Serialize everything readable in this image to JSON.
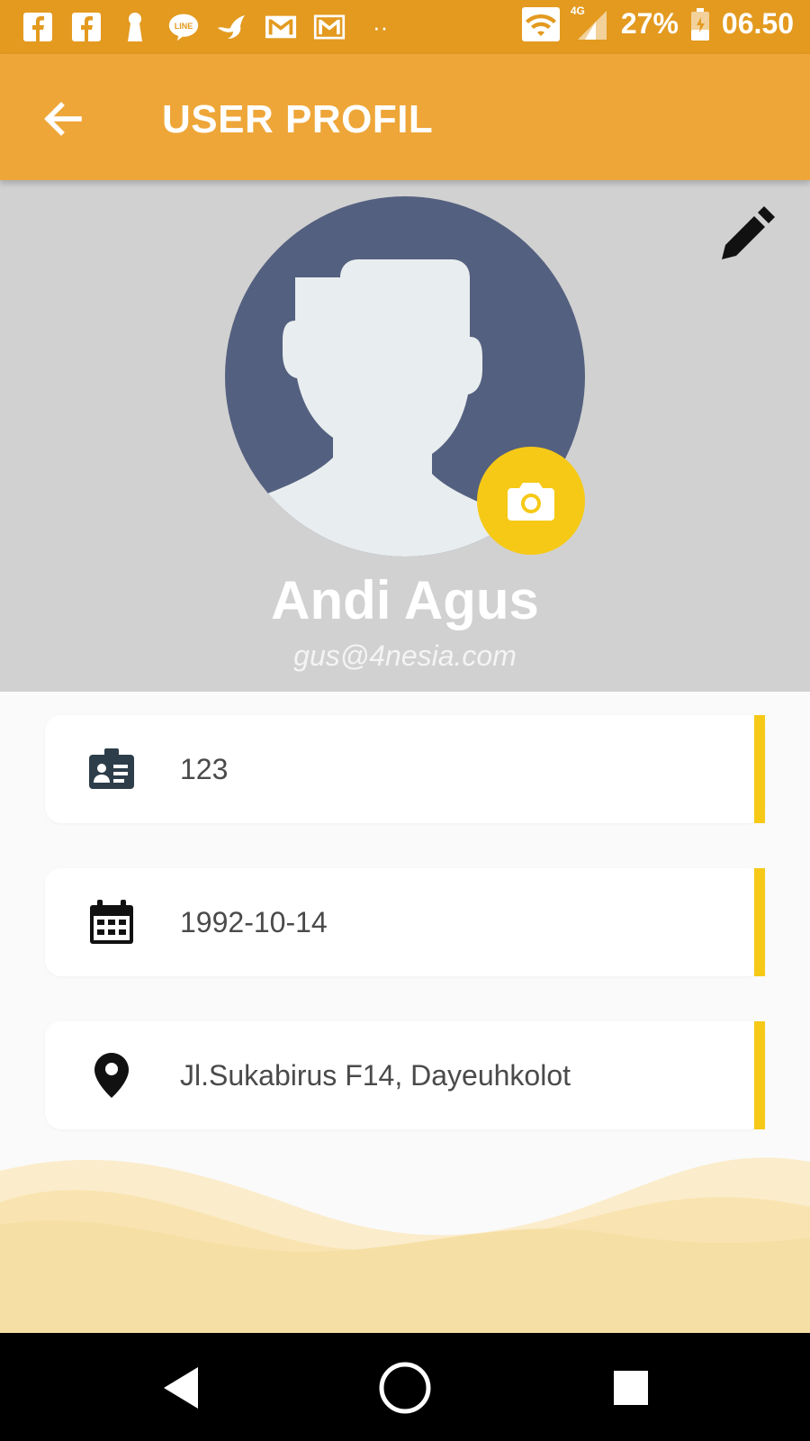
{
  "status_bar": {
    "battery": "27%",
    "time": "06.50",
    "network": "4G",
    "dots": "··",
    "notification_icons": [
      "facebook-icon",
      "facebook-icon",
      "keyhole-icon",
      "line-icon",
      "bird-icon",
      "gmail-icon",
      "gmail-icon"
    ]
  },
  "app_bar": {
    "title": "USER PROFIL"
  },
  "profile": {
    "name": "Andi Agus",
    "email": "gus@4nesia.com"
  },
  "info": [
    {
      "icon": "id-card-icon",
      "value": "123"
    },
    {
      "icon": "calendar-icon",
      "value": "1992-10-14"
    },
    {
      "icon": "location-pin-icon",
      "value": "Jl.Sukabirus F14, Dayeuhkolot"
    }
  ],
  "colors": {
    "status_bar": "#e39a1f",
    "app_bar": "#eea638",
    "accent": "#f6c916",
    "header_bg": "#d1d1d1",
    "avatar_bg": "#54607f"
  }
}
